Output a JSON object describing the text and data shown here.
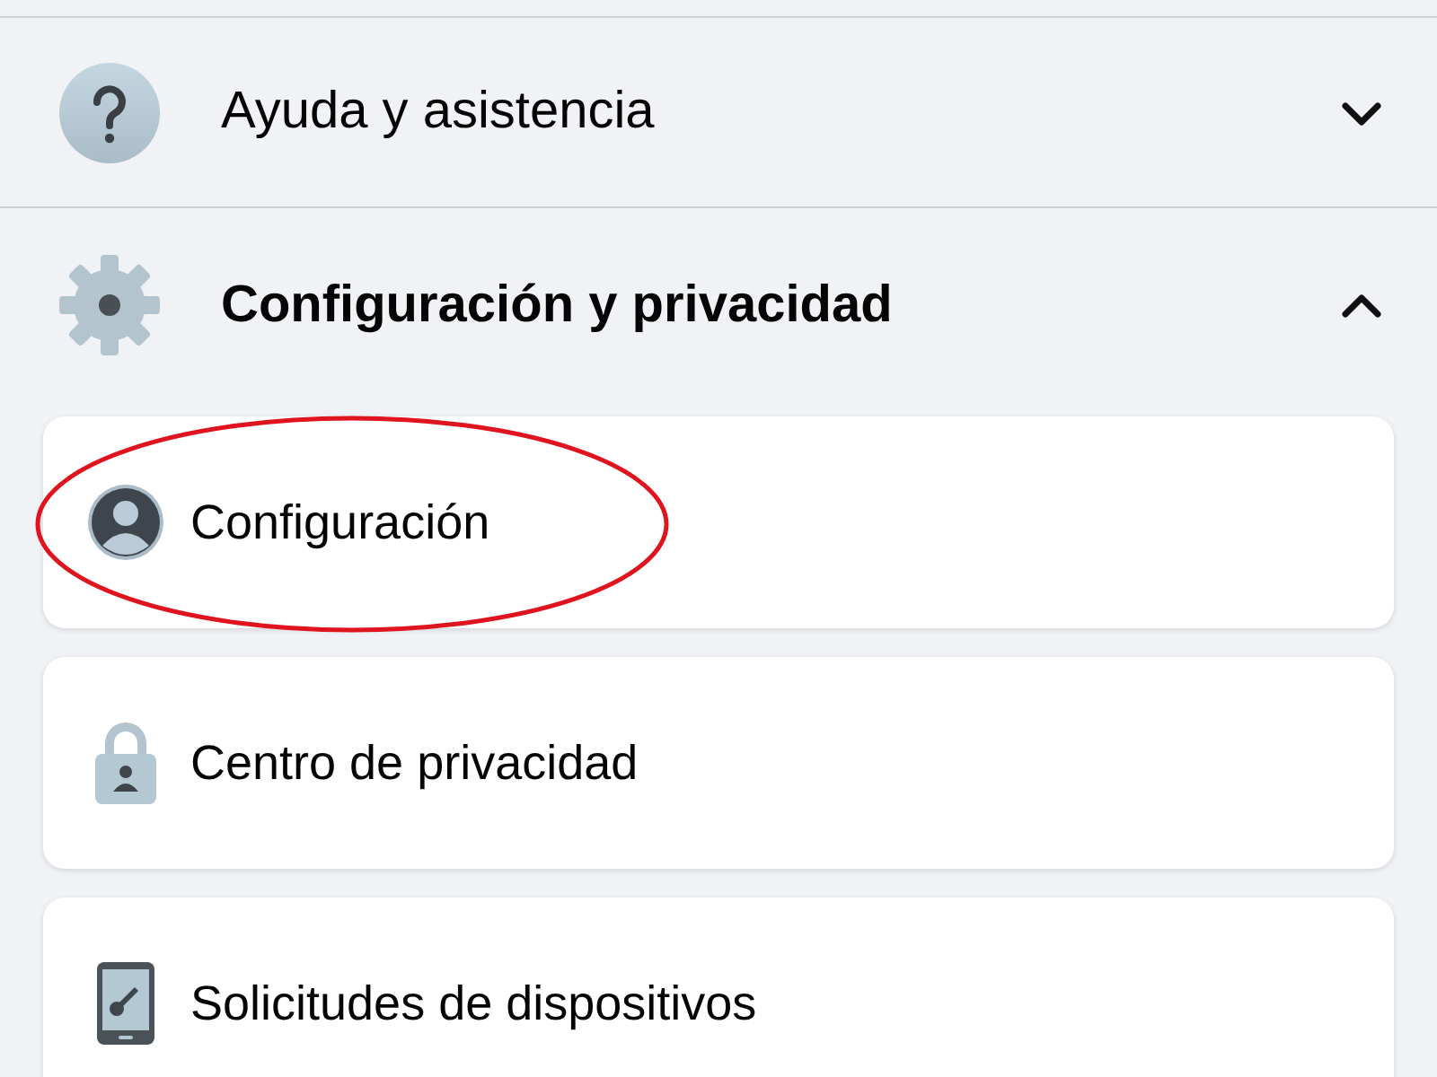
{
  "sections": [
    {
      "label": "Ayuda y asistencia",
      "kind": "help",
      "expanded": false
    },
    {
      "label": "Configuración y privacidad",
      "kind": "settings",
      "expanded": true
    }
  ],
  "items": [
    {
      "label": "Configuración",
      "kind": "profile",
      "highlighted": true
    },
    {
      "label": "Centro de privacidad",
      "kind": "lock",
      "highlighted": false
    },
    {
      "label": "Solicitudes de dispositivos",
      "kind": "device",
      "highlighted": false
    }
  ]
}
